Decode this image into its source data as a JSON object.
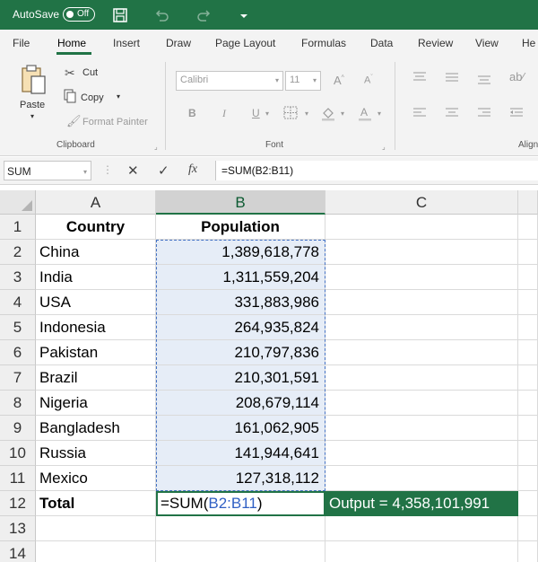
{
  "titlebar": {
    "autosave_label": "AutoSave",
    "autosave_state": "Off",
    "icons": [
      "save-icon",
      "undo-icon",
      "redo-icon",
      "customize-qat-icon"
    ]
  },
  "tabs": [
    "File",
    "Home",
    "Insert",
    "Draw",
    "Page Layout",
    "Formulas",
    "Data",
    "Review",
    "View",
    "He"
  ],
  "active_tab": "Home",
  "ribbon": {
    "clipboard": {
      "paste": "Paste",
      "cut": "Cut",
      "copy": "Copy",
      "format_painter": "Format Painter",
      "group_label": "Clipboard"
    },
    "font": {
      "font_name": "Calibri",
      "font_size": "11",
      "group_label": "Font"
    },
    "alignment": {
      "group_label": "Align"
    }
  },
  "formula_bar": {
    "name_box": "SUM",
    "formula": "=SUM(B2:B11)"
  },
  "columns": [
    "A",
    "B",
    "C"
  ],
  "rows": [
    {
      "num": "1",
      "a": "Country",
      "b": "Population"
    },
    {
      "num": "2",
      "a": "China",
      "b": "1,389,618,778"
    },
    {
      "num": "3",
      "a": "India",
      "b": "1,311,559,204"
    },
    {
      "num": "4",
      "a": "USA",
      "b": "331,883,986"
    },
    {
      "num": "5",
      "a": "Indonesia",
      "b": "264,935,824"
    },
    {
      "num": "6",
      "a": "Pakistan",
      "b": "210,797,836"
    },
    {
      "num": "7",
      "a": "Brazil",
      "b": "210,301,591"
    },
    {
      "num": "8",
      "a": "Nigeria",
      "b": "208,679,114"
    },
    {
      "num": "9",
      "a": "Bangladesh",
      "b": "161,062,905"
    },
    {
      "num": "10",
      "a": "Russia",
      "b": "141,944,641"
    },
    {
      "num": "11",
      "a": "Mexico",
      "b": "127,318,112"
    }
  ],
  "total_row": {
    "num": "12",
    "label": "Total",
    "formula_prefix": "=SUM(",
    "formula_ref": "B2:B11",
    "formula_suffix": ")",
    "output": "Output = 4,358,101,991"
  },
  "empty_rows": [
    "13",
    "14"
  ],
  "colors": {
    "accent": "#217346",
    "selection_fill": "#e6edf7",
    "reference": "#2f5fc4"
  }
}
